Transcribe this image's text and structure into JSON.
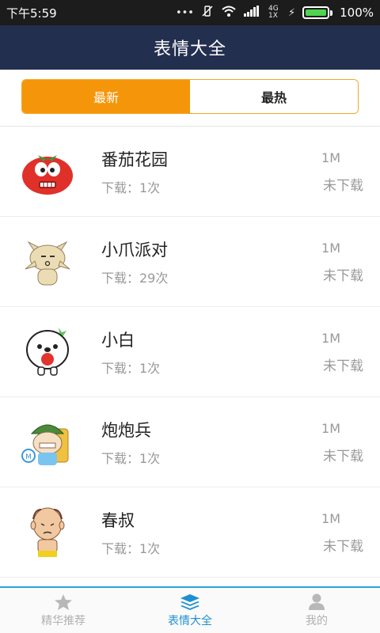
{
  "status_bar": {
    "time": "下午5:59",
    "network": "4G 1X",
    "battery": "100%",
    "battery_level": 1.0
  },
  "header": {
    "title": "表情大全"
  },
  "tabs": [
    {
      "label": "最新",
      "selected": true
    },
    {
      "label": "最热",
      "selected": false
    }
  ],
  "items": [
    {
      "name": "番茄花园",
      "downloads": "下载：1次",
      "size": "1M",
      "status": "未下载",
      "icon": "tomato-sticker"
    },
    {
      "name": "小爪派对",
      "downloads": "下载：29次",
      "size": "1M",
      "status": "未下载",
      "icon": "cat-sticker"
    },
    {
      "name": "小白",
      "downloads": "下载：1次",
      "size": "1M",
      "status": "未下载",
      "icon": "white-ghost-sticker"
    },
    {
      "name": "炮炮兵",
      "downloads": "下载：1次",
      "size": "1M",
      "status": "未下载",
      "icon": "soldier-sticker"
    },
    {
      "name": "春叔",
      "downloads": "下载：1次",
      "size": "1M",
      "status": "未下载",
      "icon": "uncle-sticker"
    }
  ],
  "bottom_nav": [
    {
      "label": "精华推荐",
      "icon": "star-icon",
      "active": false
    },
    {
      "label": "表情大全",
      "icon": "layers-icon",
      "active": true
    },
    {
      "label": "我的",
      "icon": "person-icon",
      "active": false
    }
  ],
  "colors": {
    "title_bar": "#232f4f",
    "accent_orange": "#f5960a",
    "nav_active": "#1e90d0"
  }
}
